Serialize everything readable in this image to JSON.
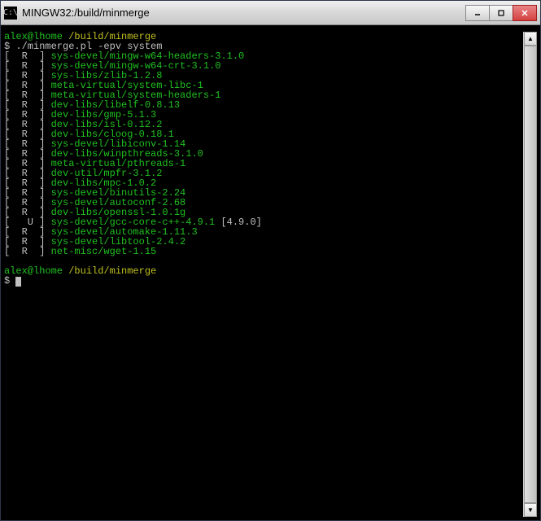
{
  "window": {
    "title": "MINGW32:/build/minmerge"
  },
  "prompt": {
    "user_host": "alex@lhome",
    "path": "/build/minmerge",
    "symbol": "$"
  },
  "command": "./minmerge.pl -epv system",
  "packages": [
    {
      "flags": "[  R  ]",
      "name": "sys-devel/mingw-w64-headers-3.1.0",
      "extra": ""
    },
    {
      "flags": "[  R  ]",
      "name": "sys-devel/mingw-w64-crt-3.1.0",
      "extra": ""
    },
    {
      "flags": "[  R  ]",
      "name": "sys-libs/zlib-1.2.8",
      "extra": ""
    },
    {
      "flags": "[  R  ]",
      "name": "meta-virtual/system-libc-1",
      "extra": ""
    },
    {
      "flags": "[  R  ]",
      "name": "meta-virtual/system-headers-1",
      "extra": ""
    },
    {
      "flags": "[  R  ]",
      "name": "dev-libs/libelf-0.8.13",
      "extra": ""
    },
    {
      "flags": "[  R  ]",
      "name": "dev-libs/gmp-5.1.3",
      "extra": ""
    },
    {
      "flags": "[  R  ]",
      "name": "dev-libs/isl-0.12.2",
      "extra": ""
    },
    {
      "flags": "[  R  ]",
      "name": "dev-libs/cloog-0.18.1",
      "extra": ""
    },
    {
      "flags": "[  R  ]",
      "name": "sys-devel/libiconv-1.14",
      "extra": ""
    },
    {
      "flags": "[  R  ]",
      "name": "dev-libs/winpthreads-3.1.0",
      "extra": ""
    },
    {
      "flags": "[  R  ]",
      "name": "meta-virtual/pthreads-1",
      "extra": ""
    },
    {
      "flags": "[  R  ]",
      "name": "dev-util/mpfr-3.1.2",
      "extra": ""
    },
    {
      "flags": "[  R  ]",
      "name": "dev-libs/mpc-1.0.2",
      "extra": ""
    },
    {
      "flags": "[  R  ]",
      "name": "sys-devel/binutils-2.24",
      "extra": ""
    },
    {
      "flags": "[  R  ]",
      "name": "sys-devel/autoconf-2.68",
      "extra": ""
    },
    {
      "flags": "[  R  ]",
      "name": "dev-libs/openssl-1.0.1g",
      "extra": ""
    },
    {
      "flags": "[   U ]",
      "name": "sys-devel/gcc-core-c++-4.9.1",
      "extra": " [4.9.0]"
    },
    {
      "flags": "[  R  ]",
      "name": "sys-devel/automake-1.11.3",
      "extra": ""
    },
    {
      "flags": "[  R  ]",
      "name": "sys-devel/libtool-2.4.2",
      "extra": ""
    },
    {
      "flags": "[  R  ]",
      "name": "net-misc/wget-1.15",
      "extra": ""
    }
  ]
}
